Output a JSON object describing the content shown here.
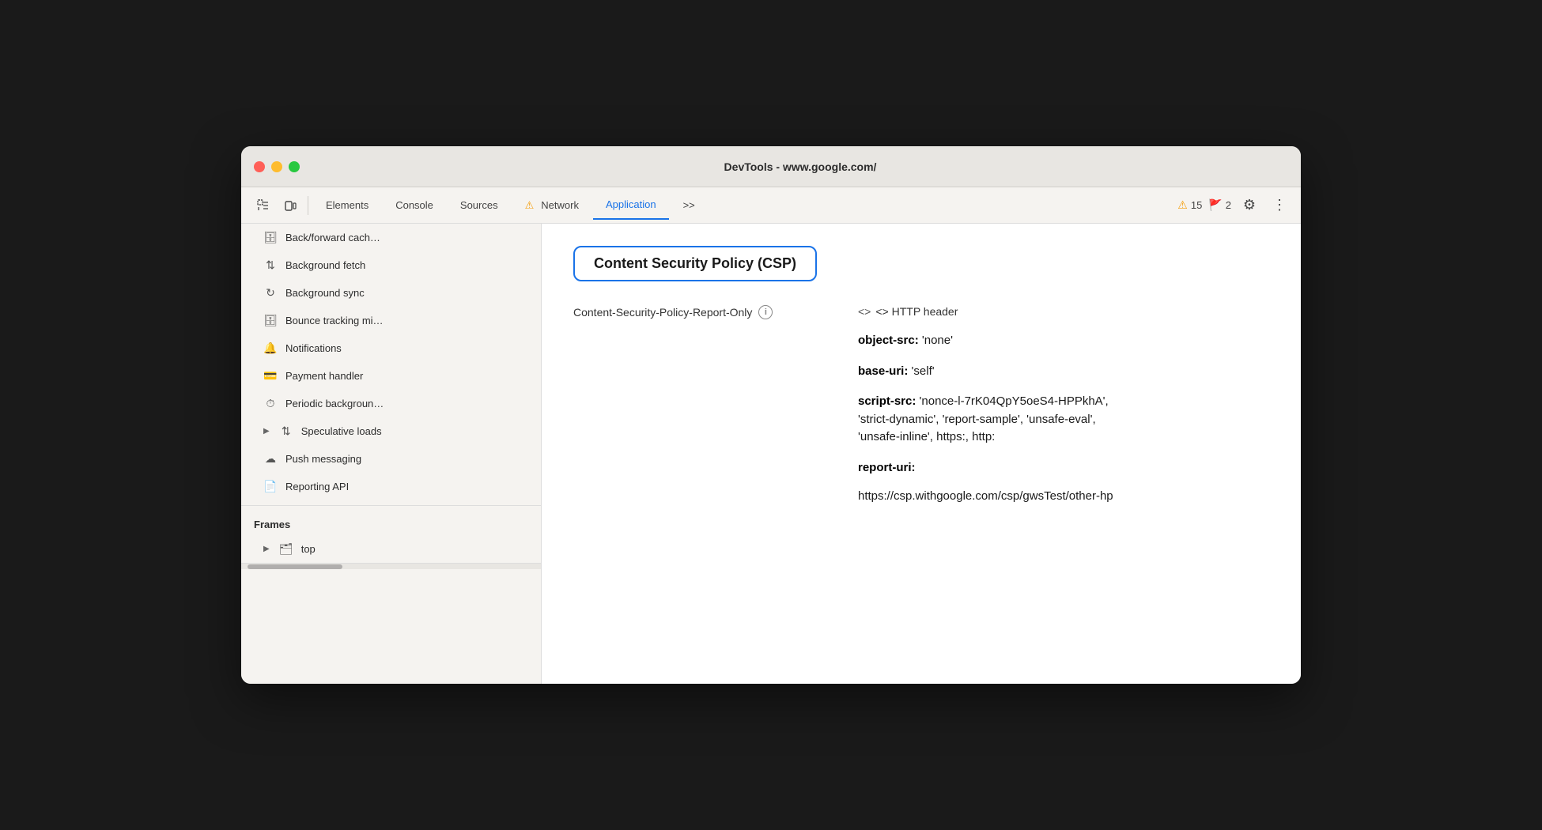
{
  "window": {
    "title": "DevTools - www.google.com/"
  },
  "toolbar": {
    "tabs": [
      {
        "id": "elements",
        "label": "Elements",
        "active": false,
        "hasWarning": false
      },
      {
        "id": "console",
        "label": "Console",
        "active": false,
        "hasWarning": false
      },
      {
        "id": "sources",
        "label": "Sources",
        "active": false,
        "hasWarning": false
      },
      {
        "id": "network",
        "label": "Network",
        "active": false,
        "hasWarning": true
      },
      {
        "id": "application",
        "label": "Application",
        "active": true,
        "hasWarning": false
      }
    ],
    "more_tabs": ">>",
    "warning_count": "15",
    "error_count": "2"
  },
  "sidebar": {
    "items": [
      {
        "id": "back-forward-cache",
        "icon": "🗄",
        "label": "Back/forward cach…"
      },
      {
        "id": "background-fetch",
        "icon": "↕",
        "label": "Background fetch"
      },
      {
        "id": "background-sync",
        "icon": "↺",
        "label": "Background sync"
      },
      {
        "id": "bounce-tracking",
        "icon": "🗄",
        "label": "Bounce tracking mi…"
      },
      {
        "id": "notifications",
        "icon": "🔔",
        "label": "Notifications"
      },
      {
        "id": "payment-handler",
        "icon": "💳",
        "label": "Payment handler"
      },
      {
        "id": "periodic-background",
        "icon": "⏱",
        "label": "Periodic backgroun…"
      },
      {
        "id": "speculative-loads",
        "icon": "↕",
        "label": "Speculative loads",
        "expandable": true
      },
      {
        "id": "push-messaging",
        "icon": "☁",
        "label": "Push messaging"
      },
      {
        "id": "reporting-api",
        "icon": "📄",
        "label": "Reporting API"
      }
    ],
    "frames_section": "Frames",
    "frames_top": "top"
  },
  "content": {
    "csp_title": "Content Security Policy (CSP)",
    "policy_label": "Content-Security-Policy-Report-Only",
    "http_header_label": "<> HTTP header",
    "object_src_label": "object-src:",
    "object_src_value": "'none'",
    "base_uri_label": "base-uri:",
    "base_uri_value": "'self'",
    "script_src_label": "script-src:",
    "script_src_value1": "'nonce-l-7rK04QpY5oeS4-HPPkhA',",
    "script_src_value2": "'strict-dynamic', 'report-sample', 'unsafe-eval',",
    "script_src_value3": "'unsafe-inline', https:, http:",
    "report_uri_label": "report-uri:",
    "report_uri_value": "https://csp.withgoogle.com/csp/gwsTest/other-hp"
  }
}
